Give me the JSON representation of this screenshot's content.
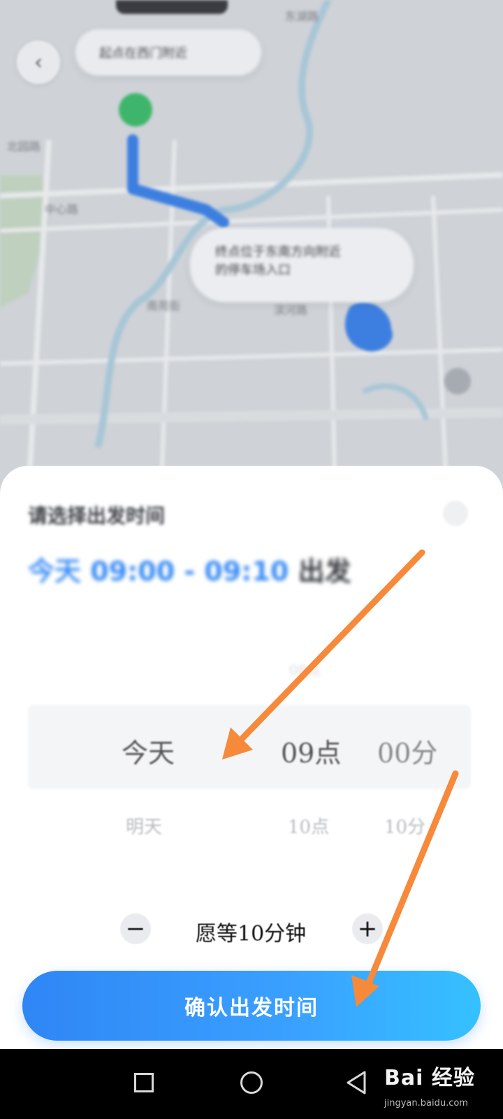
{
  "map": {
    "start_bubble_text": "起点在西门附近",
    "end_bubble_lines": [
      "终点位于东南方向附近",
      "的停车场入口"
    ],
    "place_labels": [
      "北园路",
      "中心路",
      "滨河路",
      "东湖路",
      "南苑街"
    ]
  },
  "sheet": {
    "title": "请选择出发时间",
    "time_range_blue": "今天 09:00 - 09:10",
    "time_range_dark": "出发",
    "picker": {
      "day": {
        "selected": "今天",
        "next": "明天"
      },
      "hour": {
        "selected": "09点",
        "next": "10点",
        "prev": "08点"
      },
      "minute": {
        "selected": "00分",
        "next": "10分"
      }
    },
    "wait_label": "愿等10分钟",
    "minus": "−",
    "plus": "+",
    "confirm_label": "确认出发时间"
  },
  "watermark": {
    "title": "Bai  经验",
    "subtitle": "jingyan.baidu.com"
  },
  "colors": {
    "accent_blue": "#3a8cf6",
    "route_blue": "#3d7fe0",
    "start_green": "#3fb56b",
    "arrow_orange": "#f7893a"
  }
}
